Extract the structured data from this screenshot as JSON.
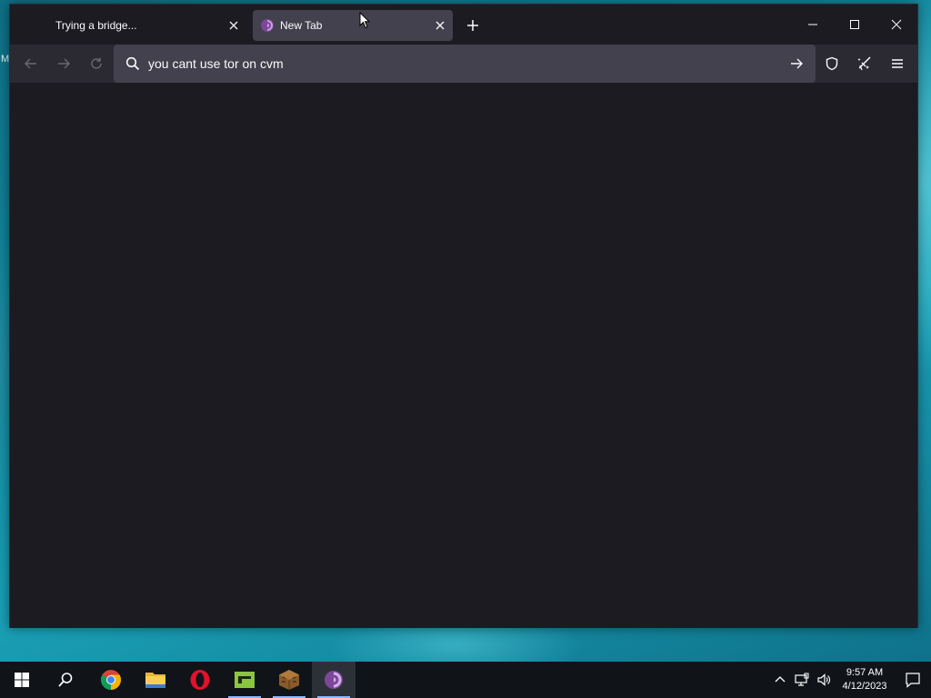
{
  "browser": {
    "tabs": [
      {
        "label": "Trying a bridge...",
        "active": false
      },
      {
        "label": "New Tab",
        "active": true
      }
    ],
    "new_tab_icon": "plus-icon",
    "window_controls": [
      "minimize-icon",
      "maximize-icon",
      "close-icon"
    ],
    "navbar": {
      "back_icon": "back-arrow-icon",
      "forward_icon": "forward-arrow-icon",
      "reload_icon": "reload-icon",
      "url_value": "you cant use tor on cvm",
      "search_icon": "search-icon",
      "go_icon": "go-arrow-icon",
      "toolbar_icons": [
        "shield-icon",
        "new-identity-broom-icon",
        "hamburger-menu-icon"
      ]
    }
  },
  "desktop": {
    "edge_labels": [
      "M"
    ]
  },
  "taskbar": {
    "apps": [
      {
        "name": "start-button",
        "icon": "windows-logo-icon"
      },
      {
        "name": "search-button",
        "icon": "search-icon"
      },
      {
        "name": "chrome-app",
        "icon": "chrome-icon"
      },
      {
        "name": "file-explorer-app",
        "icon": "folder-icon"
      },
      {
        "name": "opera-app",
        "icon": "opera-icon"
      },
      {
        "name": "green-app",
        "icon": "green-app-icon"
      },
      {
        "name": "minecraft-app",
        "icon": "minecraft-icon"
      },
      {
        "name": "tor-browser-app",
        "icon": "tor-icon"
      }
    ],
    "clock": {
      "time": "9:57 AM",
      "date": "4/12/2023"
    },
    "tray_icons": [
      "chevron-up-icon",
      "network-icon",
      "volume-icon"
    ],
    "notification_icon": "notification-icon"
  },
  "colors": {
    "window_bg": "#1c1b22",
    "toolbar_bg": "#2b2a33",
    "urlbar_bg": "#42414d",
    "text": "#fbfbfe",
    "tor_purple": "#7d4698",
    "taskbar_bg": "#101418"
  }
}
